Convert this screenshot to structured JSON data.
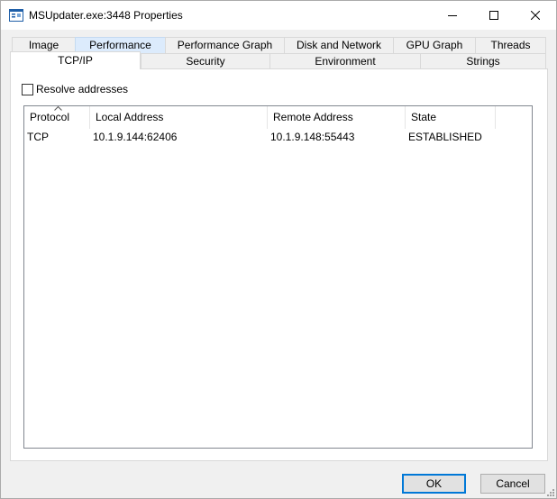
{
  "window": {
    "title": "MSUpdater.exe:3448 Properties"
  },
  "tabs_row1": [
    {
      "label": "Image"
    },
    {
      "label": "Performance"
    },
    {
      "label": "Performance Graph"
    },
    {
      "label": "Disk and Network"
    },
    {
      "label": "GPU Graph"
    },
    {
      "label": "Threads"
    }
  ],
  "tabs_row2": [
    {
      "label": "TCP/IP"
    },
    {
      "label": "Security"
    },
    {
      "label": "Environment"
    },
    {
      "label": "Strings"
    }
  ],
  "active_tab": "TCP/IP",
  "resolve_addresses": {
    "label": "Resolve addresses",
    "checked": false
  },
  "connections": {
    "columns": [
      "Protocol",
      "Local Address",
      "Remote Address",
      "State"
    ],
    "sort_column": "Protocol",
    "rows": [
      [
        "TCP",
        "10.1.9.144:62406",
        "10.1.9.148:55443",
        "ESTABLISHED"
      ]
    ]
  },
  "buttons": {
    "ok": "OK",
    "cancel": "Cancel"
  },
  "colors": {
    "hover_tab": "#dcebfc",
    "default_button_border": "#0078d7"
  }
}
